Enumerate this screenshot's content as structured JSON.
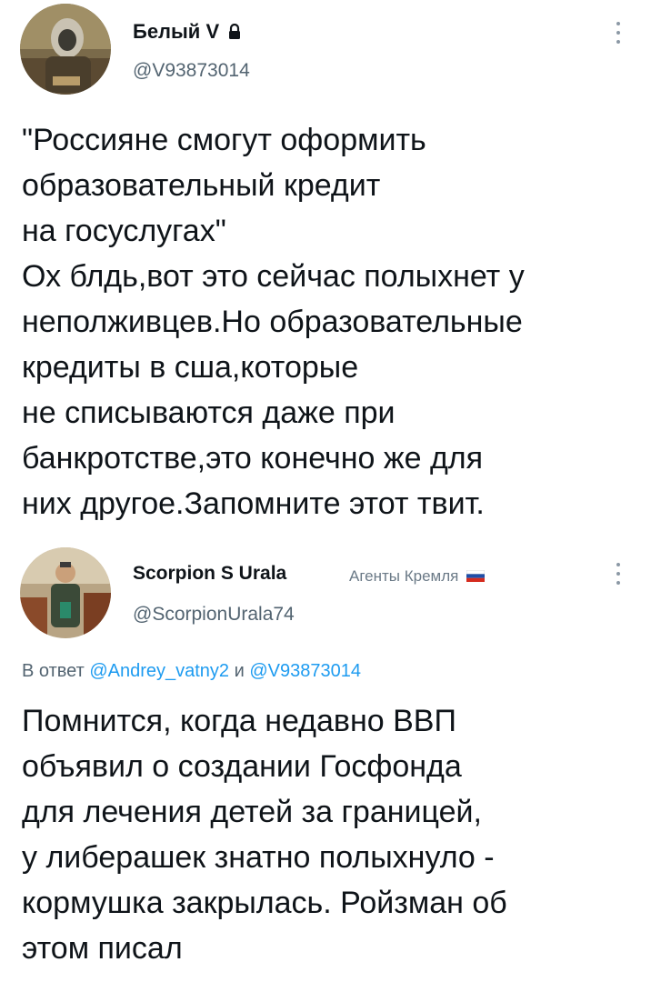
{
  "tweet1": {
    "name": "Белый V",
    "handle": "@V93873014",
    "text_lines": [
      "\"Россияне смогут оформить",
      "образовательный кредит",
      "на госуслугах\"",
      "Ох блдь,вот это сейчас полыхнет у",
      "неполживцев.Но образовательные",
      "кредиты в сша,которые",
      "не списываются даже при",
      "банкротстве,это конечно же для",
      "них другое.Запомните этот твит."
    ]
  },
  "tweet2": {
    "name": "Scorpion S Urala",
    "handle": "@ScorpionUrala74",
    "badge": "Агенты Кремля",
    "reply_prefix": "В ответ",
    "reply_to_1": "@Andrey_vatny2",
    "reply_and": "и",
    "reply_to_2": "@V93873014",
    "text_lines": [
      "Помнится, когда недавно ВВП",
      "объявил о создании Госфонда",
      "для лечения детей за границей,",
      "у либерашек знатно полыхнуло -",
      "кормушка закрылась. Ройзман об",
      "этом писал"
    ]
  },
  "colors": {
    "link": "#1d9bf0",
    "secondary": "#536471",
    "text": "#0f1419"
  }
}
